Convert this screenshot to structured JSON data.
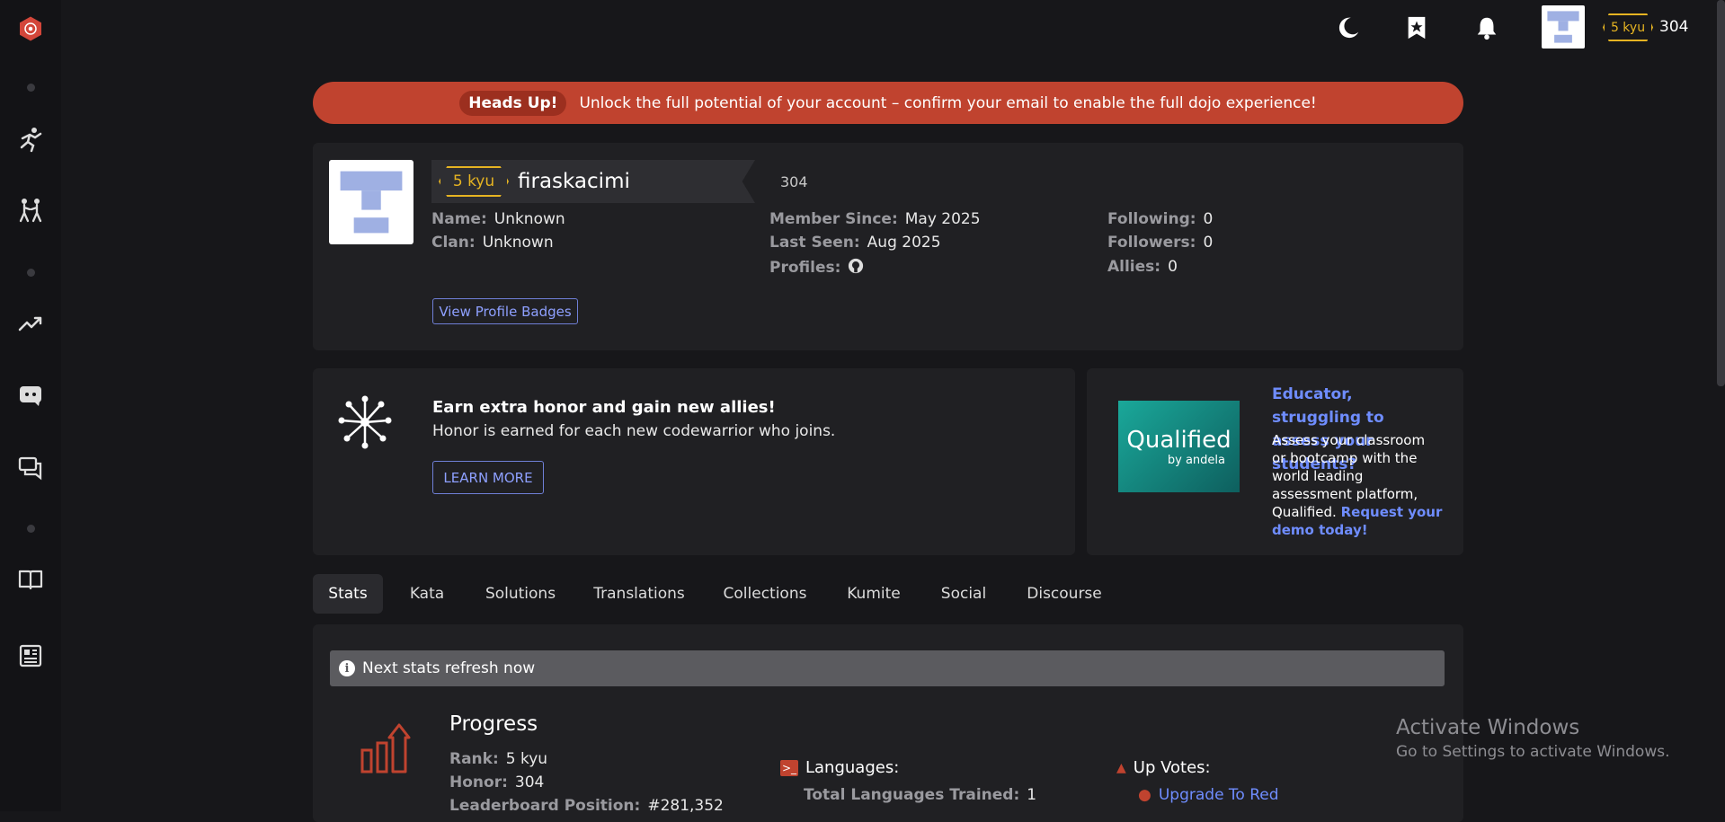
{
  "topbar": {
    "icons": [
      "moon-icon",
      "bookmark-star-icon",
      "bell-icon"
    ],
    "rank": "5 kyu",
    "honor": "304"
  },
  "sidebar": {
    "icons": [
      "logo-icon",
      "train-icon",
      "practice-icon",
      "leaderboard-icon",
      "discord-icon",
      "chat-icon",
      "docs-icon",
      "news-icon"
    ]
  },
  "banner": {
    "pill": "Heads Up!",
    "message": "Unlock the full potential of your account – confirm your email to enable the full dojo experience!"
  },
  "profile": {
    "rank": "5 kyu",
    "username": "firaskacimi",
    "honor": "304",
    "name_label": "Name:",
    "name_value": "Unknown",
    "clan_label": "Clan:",
    "clan_value": "Unknown",
    "member_since_label": "Member Since:",
    "member_since_value": "May 2025",
    "last_seen_label": "Last Seen:",
    "last_seen_value": "Aug 2025",
    "profiles_label": "Profiles:",
    "following_label": "Following:",
    "following_value": "0",
    "followers_label": "Followers:",
    "followers_value": "0",
    "allies_label": "Allies:",
    "allies_value": "0",
    "badges_button": "View Profile Badges"
  },
  "promo": {
    "title": "Earn extra honor and gain new allies!",
    "subtitle": "Honor is earned for each new codewarrior who joins.",
    "button": "LEARN MORE"
  },
  "ad": {
    "logo_text": "Qualified",
    "logo_sub": "by andela",
    "headline": "Educator, struggling to assess your students?",
    "body": "Assess your classroom or bootcamp with the world leading assessment platform, Qualified.",
    "cta": "Request your demo today!"
  },
  "tabs": [
    "Stats",
    "Kata",
    "Solutions",
    "Translations",
    "Collections",
    "Kumite",
    "Social",
    "Discourse"
  ],
  "stats": {
    "refresh_notice": "Next stats refresh now",
    "progress_title": "Progress",
    "rank_label": "Rank:",
    "rank_value": "5 kyu",
    "honor_label": "Honor:",
    "honor_value": "304",
    "leaderboard_label": "Leaderboard Position:",
    "leaderboard_value": "#281,352",
    "languages_title": "Languages:",
    "total_languages_label": "Total Languages Trained:",
    "total_languages_value": "1",
    "upvotes_title": "Up Votes:",
    "upgrade_link": "Upgrade To Red"
  },
  "watermark": {
    "title": "Activate Windows",
    "subtitle": "Go to Settings to activate Windows."
  },
  "colors": {
    "background": "#17171a",
    "panel": "#202023",
    "banner": "#c0432f",
    "rank_yellow": "#e6b422",
    "link_blue": "#6f8dff",
    "accent_red": "#c0432f"
  }
}
